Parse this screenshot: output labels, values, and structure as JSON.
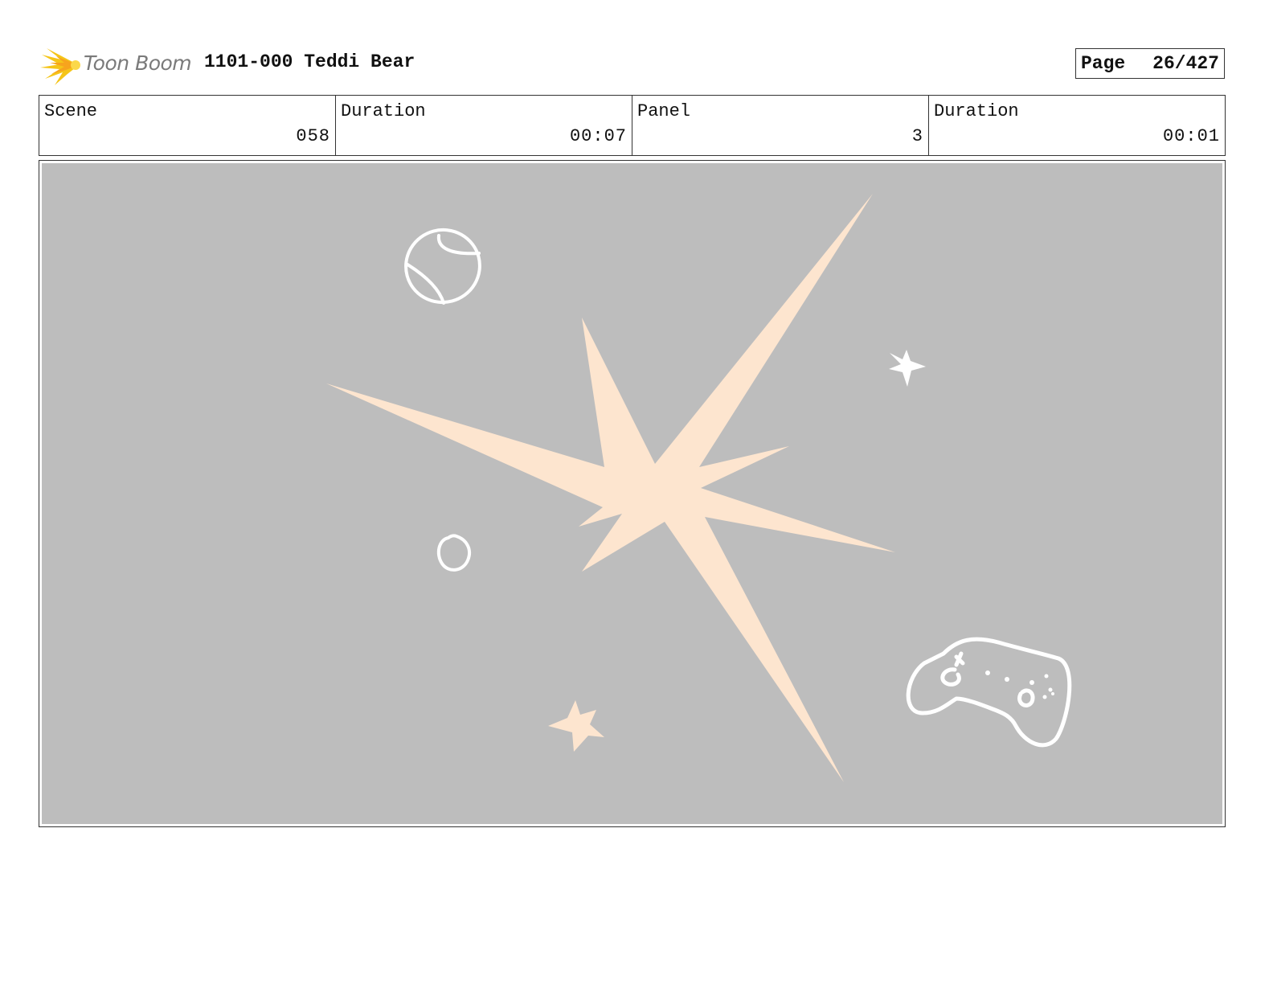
{
  "header": {
    "logo_text": "Toon Boom",
    "project_title": "1101-000 Teddi Bear",
    "page_label": "Page",
    "page_value": "26/427"
  },
  "info": {
    "scene_label": "Scene",
    "scene_value": "058",
    "scene_duration_label": "Duration",
    "scene_duration_value": "00:07",
    "panel_label": "Panel",
    "panel_value": "3",
    "panel_duration_label": "Duration",
    "panel_duration_value": "00:01"
  },
  "colors": {
    "panel_background": "#bdbdbd",
    "burst": "#fde5cf",
    "sketch_lines": "#ffffff",
    "logo_yellow": "#f5c518"
  },
  "icons": [
    "toon-boom-logo-icon",
    "explosion-burst",
    "ball-sketch",
    "star-sketch",
    "circle-sketch",
    "game-controller-sketch"
  ]
}
